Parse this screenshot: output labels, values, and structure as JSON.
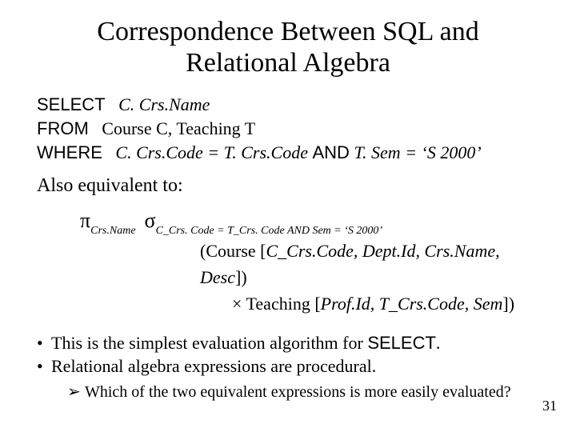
{
  "title_l1": "Correspondence Between SQL and",
  "title_l2": "Relational Algebra",
  "sql": {
    "select_kw": "SELECT",
    "select_expr": "C. Crs.Name",
    "from_kw": "FROM",
    "from_expr_a": "Course",
    "from_expr_b": " C, ",
    "from_expr_c": "Teaching",
    "from_expr_d": " T",
    "where_kw": "WHERE",
    "where_expr_a": "C. Crs.Code = T. Crs.Code ",
    "and_kw": "AND",
    "where_expr_b": " T. Sem = ‘S 2000’"
  },
  "also": "Also equivalent to:",
  "ra": {
    "pi": "π",
    "pi_sub": "Crs.Name",
    "sigma": "σ",
    "sigma_sub": "C_Crs. Code = T_Crs. Code AND Sem = ‘S 2000’",
    "line2_a": "(",
    "line2_course": "Course",
    "line2_b": " [",
    "line2_cols": "C_Crs.Code, Dept.Id, Crs.Name, Desc",
    "line2_c": "]",
    "line2_d": ")",
    "line3_times": "×  ",
    "line3_teaching": "Teaching",
    "line3_a": " [",
    "line3_cols": "Prof.Id, T_Crs.Code, Sem",
    "line3_b": "])"
  },
  "bullets": {
    "b1_a": "This is the simplest evaluation algorithm for ",
    "b1_b": "SELECT",
    "b1_c": ".",
    "b2": "Relational algebra expressions are procedural.",
    "sub1": "Which of the two equivalent expressions is more easily evaluated?"
  },
  "pagenum": "31"
}
